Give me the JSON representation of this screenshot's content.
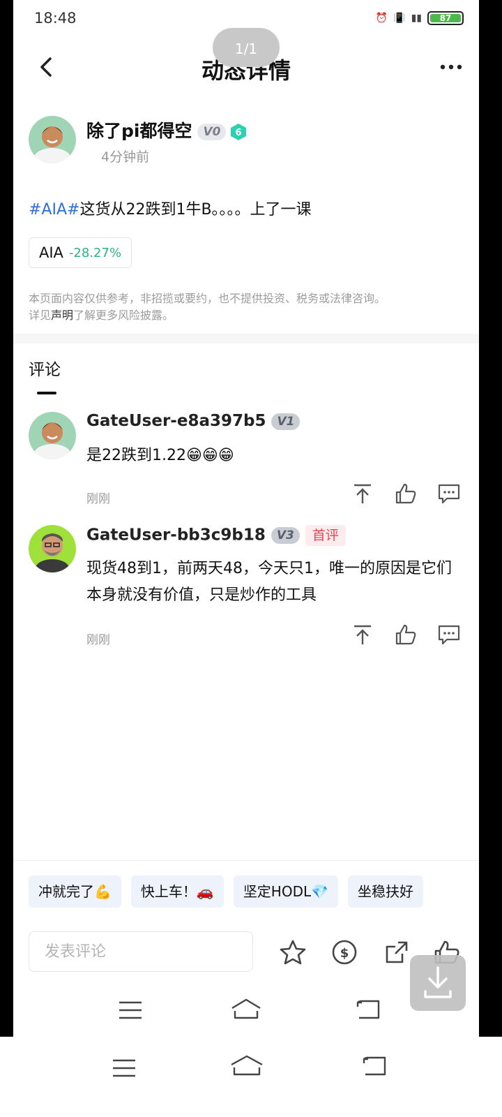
{
  "status_bar": {
    "time": "18:48",
    "battery": "87"
  },
  "page_counter": "1/1",
  "header": {
    "title": "动态详情"
  },
  "post": {
    "author_name": "除了pi都得空",
    "author_level": "V0",
    "author_badge_number": "6",
    "time": "4分钟前",
    "tag": "#AIA#",
    "text": "这货从22跌到1牛B。。。。上了一课",
    "ticker_symbol": "AIA",
    "ticker_change": "-28.27%"
  },
  "disclaimer": {
    "line1": "本页面内容仅供参考，非招揽或要约，也不提供投资、税务或法律咨询。",
    "prefix": "详见",
    "link": "声明",
    "suffix": "了解更多风险披露。"
  },
  "comments_tab": "评论",
  "comments": [
    {
      "name": "GateUser-e8a397b5",
      "level": "V1",
      "body": "是22跌到1.22😁😁😁",
      "time": "刚刚"
    },
    {
      "name": "GateUser-bb3c9b18",
      "level": "V3",
      "badge": "首评",
      "body": "现货48到1，前两天48，今天只1，唯一的原因是它们本身就没有价值，只是炒作的工具",
      "time": "刚刚"
    }
  ],
  "quick_replies": [
    "冲就完了💪",
    "快上车！🚗",
    "坚定HODL💎",
    "坐稳扶好"
  ],
  "comment_input_placeholder": "发表评论"
}
